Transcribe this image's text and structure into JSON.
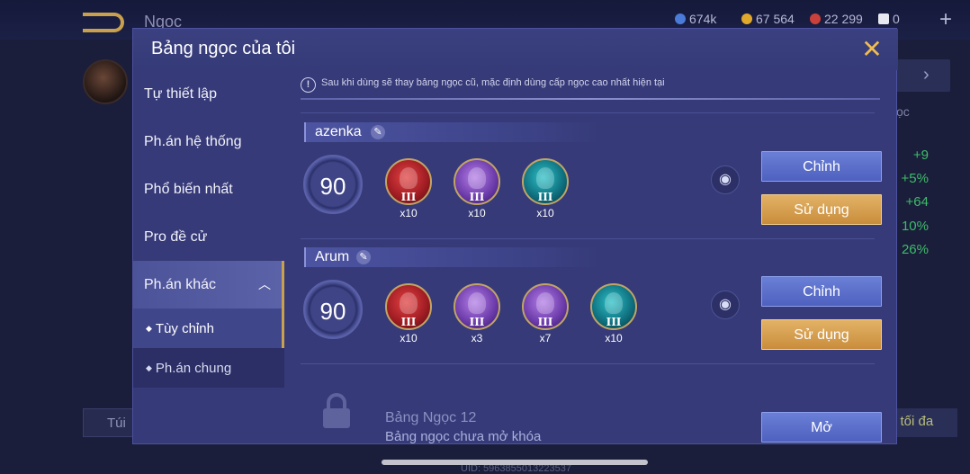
{
  "background": {
    "title": "Ngọc",
    "currencies": [
      {
        "value": "674k",
        "icon": "blue-gem-icon",
        "color": "#4a7bd8"
      },
      {
        "value": "67 564",
        "icon": "gold-coin-icon",
        "color": "#e0a92b"
      },
      {
        "value": "22 299",
        "icon": "red-gem-icon",
        "color": "#c9413a"
      },
      {
        "value": "0",
        "icon": "card-icon",
        "color": "#e8e8f0"
      }
    ],
    "right_label": "ọc",
    "stats": [
      "+9",
      "+5%",
      "+64",
      "10%",
      "26%"
    ],
    "bag_label": "Túi",
    "max_label": "o tối đa",
    "uid": "UID: 5963855013223537"
  },
  "dialog": {
    "title": "Bảng ngọc của tôi",
    "close_icon": "close-icon"
  },
  "sidebar": {
    "items": [
      {
        "label": "Tự thiết lập"
      },
      {
        "label": "Ph.án hệ thống"
      },
      {
        "label": "Phổ biến nhất"
      },
      {
        "label": "Pro đề cử"
      },
      {
        "label": "Ph.án khác",
        "expanded": true
      }
    ],
    "subitems": [
      {
        "label": "Tùy chỉnh",
        "selected": true
      },
      {
        "label": "Ph.án chung",
        "selected": false
      }
    ]
  },
  "notice": "Sau khi dùng sẽ thay bảng ngọc cũ, mặc định dùng cấp ngọc cao nhất hiện tại",
  "pages": [
    {
      "name": "azenka",
      "level": "90",
      "gems": [
        {
          "color": "red",
          "tier": "III",
          "count": "x10"
        },
        {
          "color": "purple",
          "tier": "III",
          "count": "x10"
        },
        {
          "color": "teal",
          "tier": "III",
          "count": "x10"
        }
      ],
      "edit_label": "Chỉnh",
      "use_label": "Sử dụng"
    },
    {
      "name": "Arum",
      "level": "90",
      "gems": [
        {
          "color": "red",
          "tier": "III",
          "count": "x10"
        },
        {
          "color": "purple",
          "tier": "III",
          "count": "x3"
        },
        {
          "color": "purple",
          "tier": "III",
          "count": "x7"
        },
        {
          "color": "teal",
          "tier": "III",
          "count": "x10"
        }
      ],
      "edit_label": "Chỉnh",
      "use_label": "Sử dụng"
    }
  ],
  "locked_page": {
    "title": "Bảng Ngọc 12",
    "subtitle": "Bảng ngọc chưa mở khóa",
    "unlock_label": "Mở"
  }
}
